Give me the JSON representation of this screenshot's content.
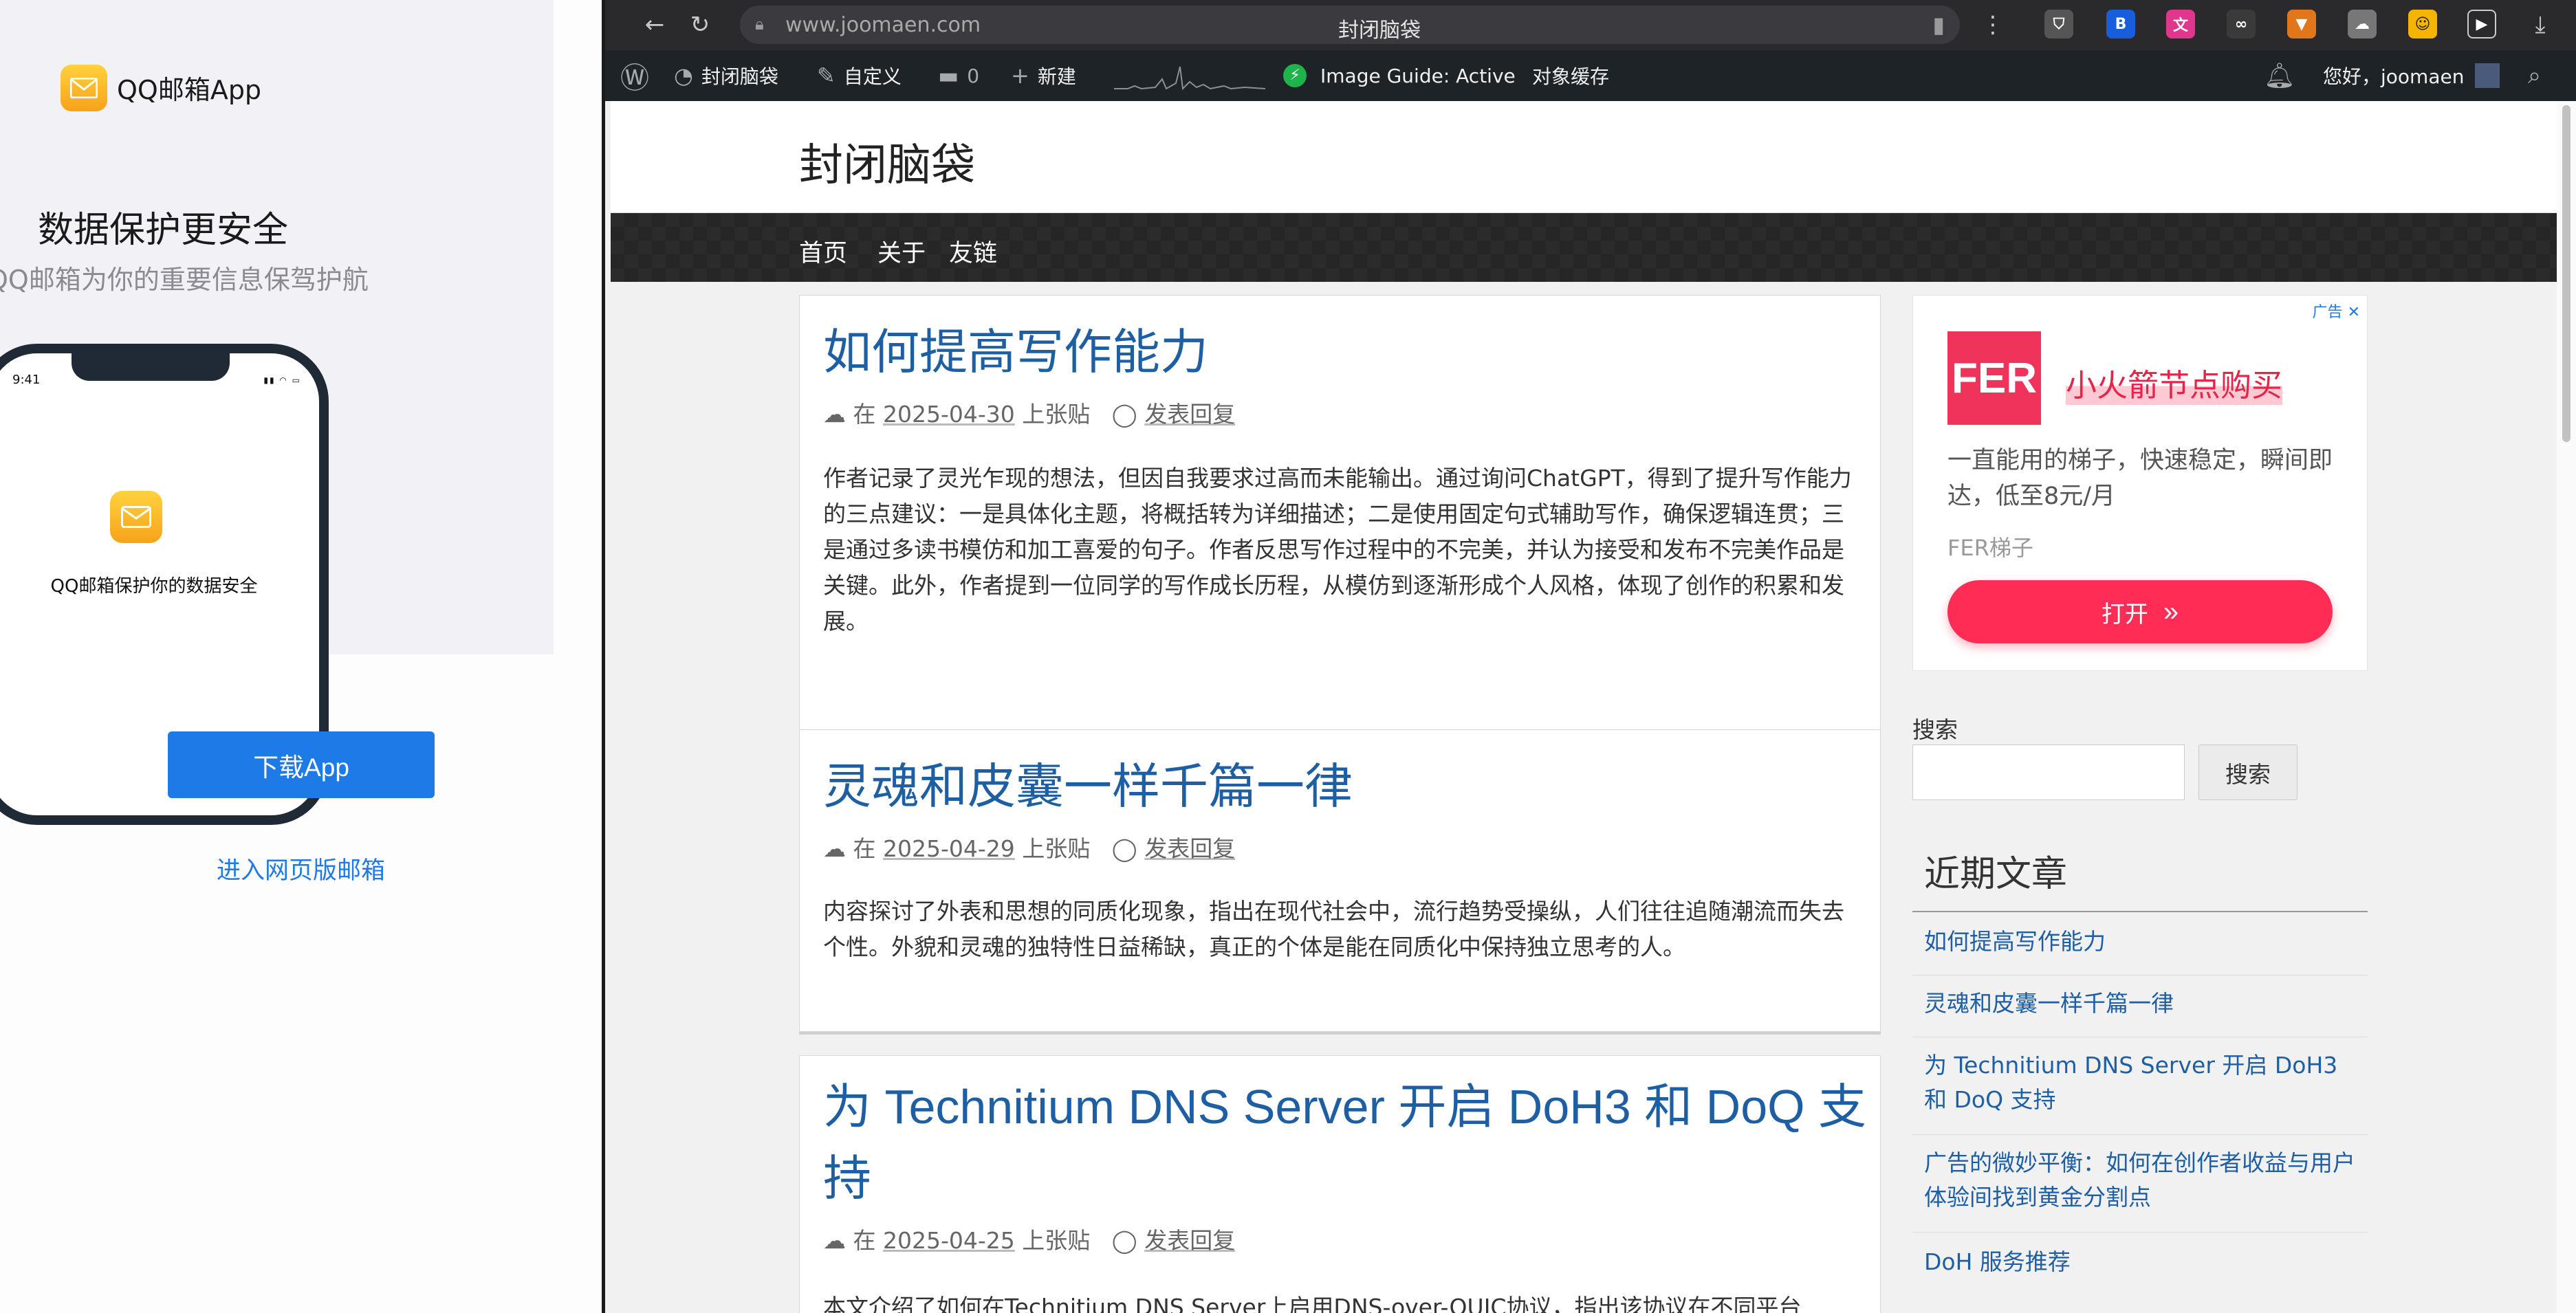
{
  "qq": {
    "brand": "QQ邮箱App",
    "headline": "数据保护更安全",
    "subline": "QQ邮箱为你的重要信息保驾护航",
    "phone_time": "9:41",
    "phone_caption": "QQ邮箱保护你的数据安全",
    "download_label": "下载App",
    "web_label": "进入网页版邮箱"
  },
  "browser": {
    "url": "www.joomaen.com",
    "tab_title": "封闭脑袋",
    "extensions": [
      "shield",
      "bitwarden",
      "translate",
      "glasses",
      "metamask",
      "cloud",
      "face",
      "play",
      "download"
    ]
  },
  "adminbar": {
    "site": "封闭脑袋",
    "customize": "自定义",
    "comments": "0",
    "new": "新建",
    "image_guide": "Image Guide: Active",
    "cache": "对象缓存",
    "greeting": "您好，joomaen"
  },
  "site": {
    "title": "封闭脑袋",
    "nav": [
      "首页",
      "关于",
      "友链"
    ]
  },
  "posts": [
    {
      "title": "如何提高写作能力",
      "prefix": "在",
      "date": "2025-04-30",
      "author": "上张贴",
      "reply": "发表回复",
      "excerpt": "作者记录了灵光乍现的想法，但因自我要求过高而未能输出。通过询问ChatGPT，得到了提升写作能力的三点建议：一是具体化主题，将概括转为详细描述；二是使用固定句式辅助写作，确保逻辑连贯；三是通过多读书模仿和加工喜爱的句子。作者反思写作过程中的不完美，并认为接受和发布不完美作品是关键。此外，作者提到一位同学的写作成长历程，从模仿到逐渐形成个人风格，体现了创作的积累和发展。"
    },
    {
      "title": "灵魂和皮囊一样千篇一律",
      "prefix": "在",
      "date": "2025-04-29",
      "author": "上张贴",
      "reply": "发表回复",
      "excerpt": "内容探讨了外表和思想的同质化现象，指出在现代社会中，流行趋势受操纵，人们往往追随潮流而失去个性。外貌和灵魂的独特性日益稀缺，真正的个体是能在同质化中保持独立思考的人。"
    },
    {
      "title": "为 Technitium DNS Server 开启 DoH3 和 DoQ 支持",
      "prefix": "在",
      "date": "2025-04-25",
      "author": "上张贴",
      "reply": "发表回复",
      "excerpt": "本文介绍了如何在Technitium DNS Server上启用DNS-over-QUIC协议，指出该协议在不同平台"
    }
  ],
  "ad": {
    "label": "广告",
    "logo": "FER",
    "headline": "小火箭节点购买",
    "desc": "一直能用的梯子，快速稳定，瞬间即达，低至8元/月",
    "brand": "FER梯子",
    "button": "打开"
  },
  "sidebar": {
    "search_label": "搜索",
    "search_button": "搜索",
    "recent_title": "近期文章",
    "recent": [
      "如何提高写作能力",
      "灵魂和皮囊一样千篇一律",
      "为 Technitium DNS Server 开启 DoH3 和 DoQ 支持",
      "广告的微妙平衡：如何在创作者收益与用户体验间找到黄金分割点",
      "DoH 服务推荐"
    ]
  }
}
